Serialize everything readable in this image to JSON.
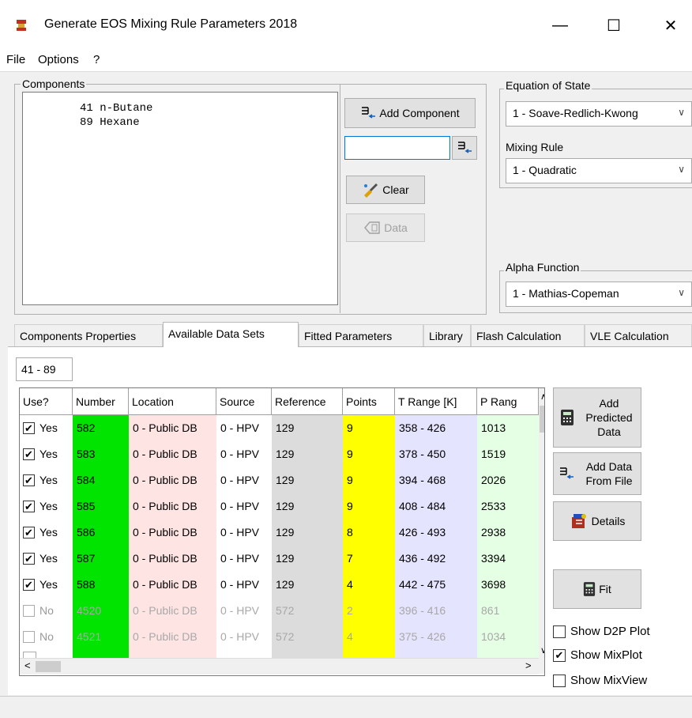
{
  "window": {
    "title": "Generate EOS Mixing Rule Parameters 2018",
    "minimize": "—",
    "maximize": "☐",
    "close": "✕"
  },
  "menu": [
    "File",
    "Options",
    "?"
  ],
  "components": {
    "label": "Components",
    "items": [
      "41 n-Butane",
      "89 Hexane"
    ],
    "add_label": "Add Component",
    "input_value": "",
    "clear_label": "Clear",
    "data_label": "Data"
  },
  "eos": {
    "label": "Equation of State",
    "value": "1 - Soave-Redlich-Kwong"
  },
  "mixing_rule": {
    "label": "Mixing Rule",
    "value": "1 - Quadratic"
  },
  "alpha": {
    "label": "Alpha Function",
    "value": "1 - Mathias-Copeman"
  },
  "tabs": [
    "Components Properties",
    "Available Data Sets",
    "Fitted Parameters",
    "Library",
    "Flash Calculation",
    "VLE Calculation"
  ],
  "active_tab": "Available Data Sets",
  "subtab": "41 - 89",
  "grid": {
    "headers": [
      "Use?",
      "Number",
      "Location",
      "Source",
      "Reference",
      "Points",
      "T Range [K]",
      "P Rang"
    ],
    "rows": [
      {
        "use": true,
        "label": "Yes",
        "number": "582",
        "location": "0 - Public DB",
        "source": "0 - HPV",
        "reference": "129",
        "points": "9",
        "trange": "358 - 426",
        "prange": "1013"
      },
      {
        "use": true,
        "label": "Yes",
        "number": "583",
        "location": "0 - Public DB",
        "source": "0 - HPV",
        "reference": "129",
        "points": "9",
        "trange": "378 - 450",
        "prange": "1519"
      },
      {
        "use": true,
        "label": "Yes",
        "number": "584",
        "location": "0 - Public DB",
        "source": "0 - HPV",
        "reference": "129",
        "points": "9",
        "trange": "394 - 468",
        "prange": "2026"
      },
      {
        "use": true,
        "label": "Yes",
        "number": "585",
        "location": "0 - Public DB",
        "source": "0 - HPV",
        "reference": "129",
        "points": "9",
        "trange": "408 - 484",
        "prange": "2533"
      },
      {
        "use": true,
        "label": "Yes",
        "number": "586",
        "location": "0 - Public DB",
        "source": "0 - HPV",
        "reference": "129",
        "points": "8",
        "trange": "426 - 493",
        "prange": "2938"
      },
      {
        "use": true,
        "label": "Yes",
        "number": "587",
        "location": "0 - Public DB",
        "source": "0 - HPV",
        "reference": "129",
        "points": "7",
        "trange": "436 - 492",
        "prange": "3394"
      },
      {
        "use": true,
        "label": "Yes",
        "number": "588",
        "location": "0 - Public DB",
        "source": "0 - HPV",
        "reference": "129",
        "points": "4",
        "trange": "442 - 475",
        "prange": "3698"
      },
      {
        "use": false,
        "label": "No",
        "number": "4520",
        "location": "0 - Public DB",
        "source": "0 - HPV",
        "reference": "572",
        "points": "2",
        "trange": "396 - 416",
        "prange": "861"
      },
      {
        "use": false,
        "label": "No",
        "number": "4521",
        "location": "0 - Public DB",
        "source": "0 - HPV",
        "reference": "572",
        "points": "4",
        "trange": "375 - 426",
        "prange": "1034"
      }
    ]
  },
  "side_buttons": {
    "add_predicted": "Add Predicted Data",
    "add_file": "Add Data From File",
    "details": "Details",
    "fit": "Fit"
  },
  "options": [
    {
      "label": "Show D2P Plot",
      "checked": false
    },
    {
      "label": "Show MixPlot",
      "checked": true
    },
    {
      "label": "Show MixView",
      "checked": false
    }
  ],
  "colors": {
    "number_col": "#00e400",
    "location_col": "#ffe4e4",
    "reference_col": "#dcdcdc",
    "points_col": "#ffff00",
    "trange_col": "#e4e4ff",
    "prange_col": "#e4ffe4"
  }
}
